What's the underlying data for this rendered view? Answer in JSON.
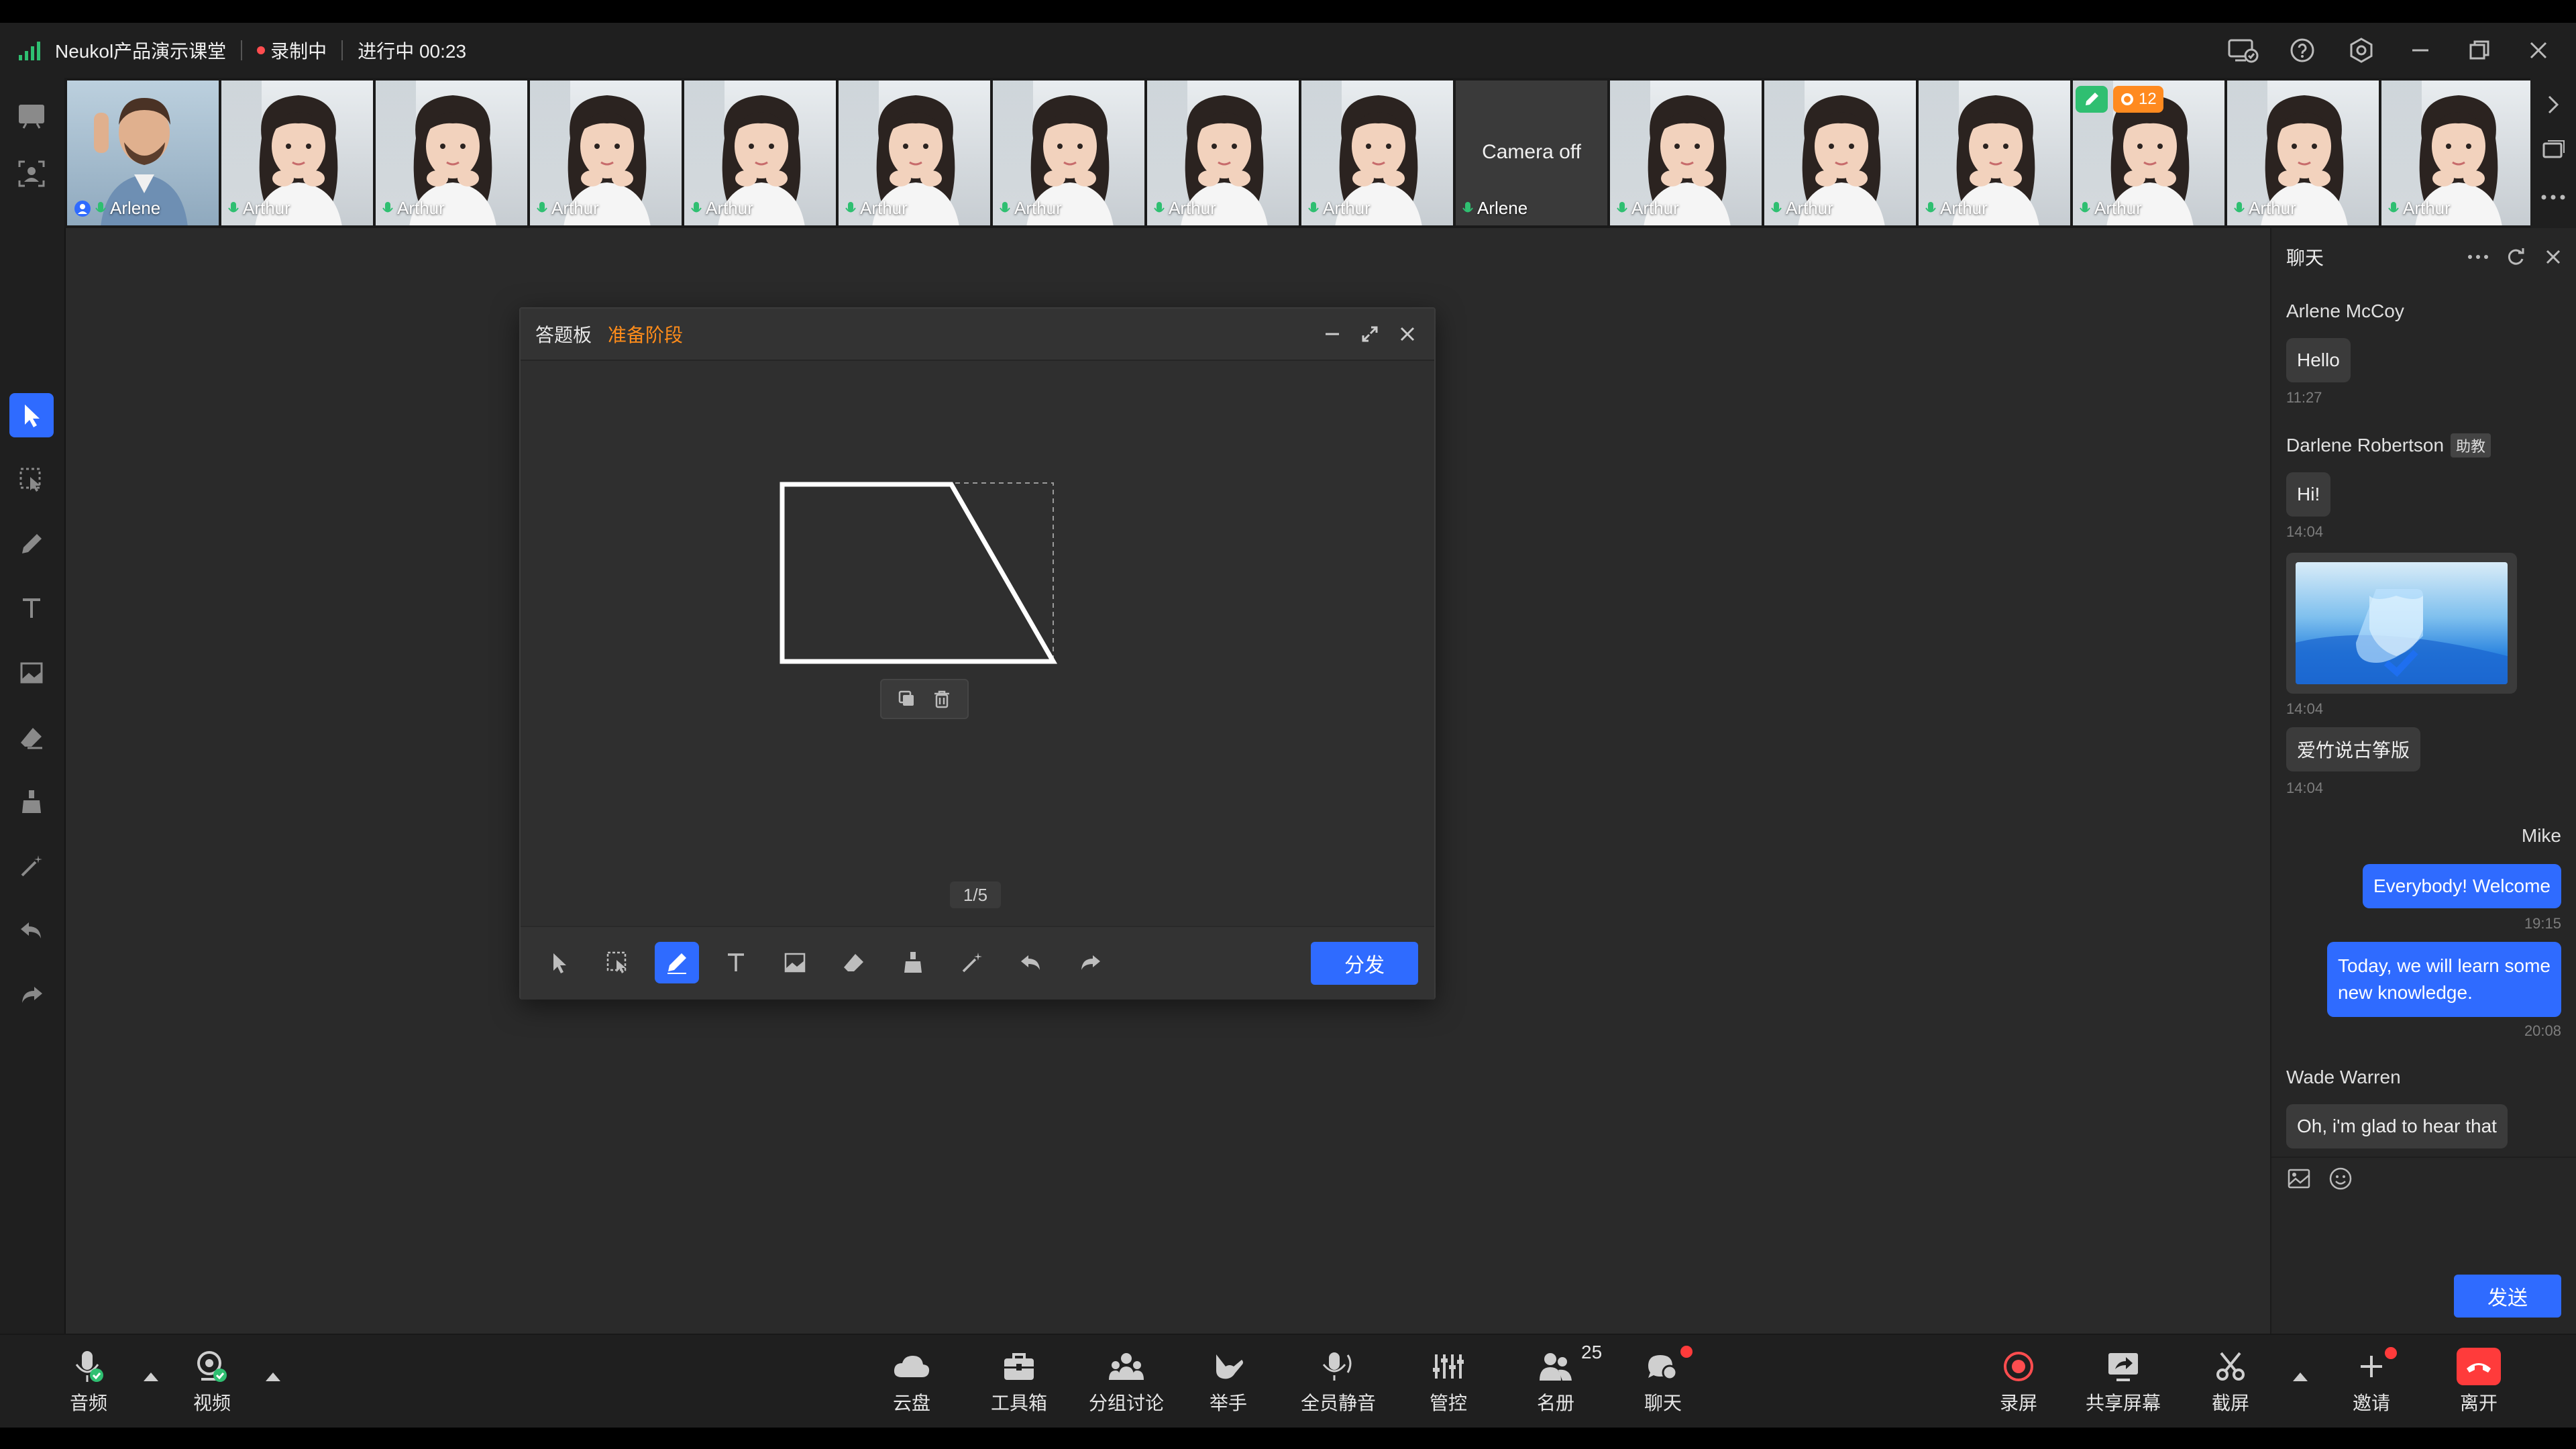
{
  "titlebar": {
    "app_name": "Neukol产品演示课堂",
    "recording": "录制中",
    "status": "进行中 00:23"
  },
  "video_strip": {
    "tiles": [
      {
        "name": "Arlene",
        "type": "teacher"
      },
      {
        "name": "Arthur"
      },
      {
        "name": "Arthur"
      },
      {
        "name": "Arthur"
      },
      {
        "name": "Arthur"
      },
      {
        "name": "Arthur"
      },
      {
        "name": "Arthur"
      },
      {
        "name": "Arthur"
      },
      {
        "name": "Arthur"
      },
      {
        "name": "Arlene",
        "camera_text": "Camera off"
      },
      {
        "name": "Arthur"
      },
      {
        "name": "Arthur"
      },
      {
        "name": "Arthur"
      },
      {
        "name": "Arthur",
        "reward_count": "12"
      },
      {
        "name": "Arthur"
      },
      {
        "name": "Arthur"
      }
    ]
  },
  "board": {
    "title": "答题板",
    "stage": "准备阶段",
    "page": "1/5",
    "distribute_label": "分发"
  },
  "chat": {
    "title": "聊天",
    "messages": [
      {
        "sender": "Arlene McCoy",
        "text": "Hello",
        "time": "11:27"
      },
      {
        "sender": "Darlene Robertson",
        "tag": "助教",
        "text": "Hi!",
        "time": "14:04"
      },
      {
        "type": "image",
        "time": "14:04"
      },
      {
        "text": "爱竹说古筝版",
        "time": "14:04"
      },
      {
        "sender": "Mike",
        "self": true,
        "text": "Everybody! Welcome",
        "time": "19:15"
      },
      {
        "self": true,
        "text_line1": "Today, we will learn some",
        "text_line2": "new knowledge.",
        "time": "20:08"
      },
      {
        "sender": "Wade Warren",
        "text": "Oh, i'm glad to hear that"
      }
    ],
    "send_label": "发送"
  },
  "toolbar": {
    "audio": "音频",
    "video": "视频",
    "cloud": "云盘",
    "toolbox": "工具箱",
    "breakout": "分组讨论",
    "raise_hand": "举手",
    "mute_all": "全员静音",
    "control": "管控",
    "roster": "名册",
    "roster_count": "25",
    "chat": "聊天",
    "record": "录屏",
    "share_screen": "共享屏幕",
    "screenshot": "截屏",
    "invite": "邀请",
    "leave": "离开"
  },
  "colors": {
    "accent": "#2f6bff",
    "stage_orange": "#ff8c1a",
    "record_red": "#ff4d4f",
    "leave_red": "#ff3b3b",
    "mic_green": "#2fbf71"
  }
}
